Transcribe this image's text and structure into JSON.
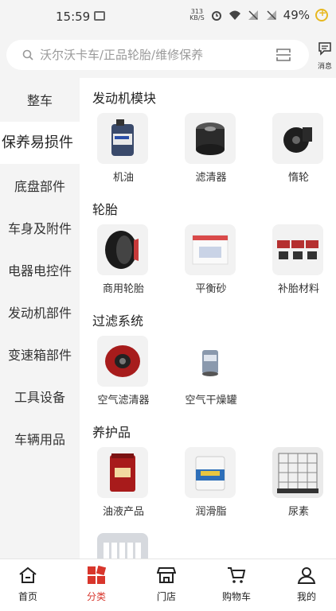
{
  "status": {
    "time": "15:59",
    "net_speed": "313",
    "net_unit": "KB/S",
    "battery": "49%"
  },
  "search": {
    "placeholder": "沃尔沃卡车/正品轮胎/维修保养",
    "message_label": "消息"
  },
  "sidebar": {
    "items": [
      {
        "label": "整车"
      },
      {
        "label": "保养易损件",
        "active": true
      },
      {
        "label": "底盘部件"
      },
      {
        "label": "车身及附件"
      },
      {
        "label": "电器电控件"
      },
      {
        "label": "发动机部件"
      },
      {
        "label": "变速箱部件"
      },
      {
        "label": "工具设备"
      },
      {
        "label": "车辆用品"
      }
    ]
  },
  "sections": [
    {
      "title": "发动机模块",
      "items": [
        {
          "label": "机油"
        },
        {
          "label": "滤清器"
        },
        {
          "label": "惰轮"
        }
      ]
    },
    {
      "title": "轮胎",
      "items": [
        {
          "label": "商用轮胎"
        },
        {
          "label": "平衡砂"
        },
        {
          "label": "补胎材料"
        }
      ]
    },
    {
      "title": "过滤系统",
      "items": [
        {
          "label": "空气滤清器"
        },
        {
          "label": "空气干燥罐"
        }
      ]
    },
    {
      "title": "养护品",
      "items": [
        {
          "label": "油液产品"
        },
        {
          "label": "润滑脂"
        },
        {
          "label": "尿素"
        },
        {
          "label": ""
        }
      ]
    }
  ],
  "bottom_nav": {
    "items": [
      {
        "label": "首页"
      },
      {
        "label": "分类",
        "active": true
      },
      {
        "label": "门店"
      },
      {
        "label": "购物车"
      },
      {
        "label": "我的"
      }
    ]
  },
  "colors": {
    "accent": "#d8362c",
    "sidebar_bg": "#f4f4f4",
    "content_bg": "#ffffff"
  }
}
